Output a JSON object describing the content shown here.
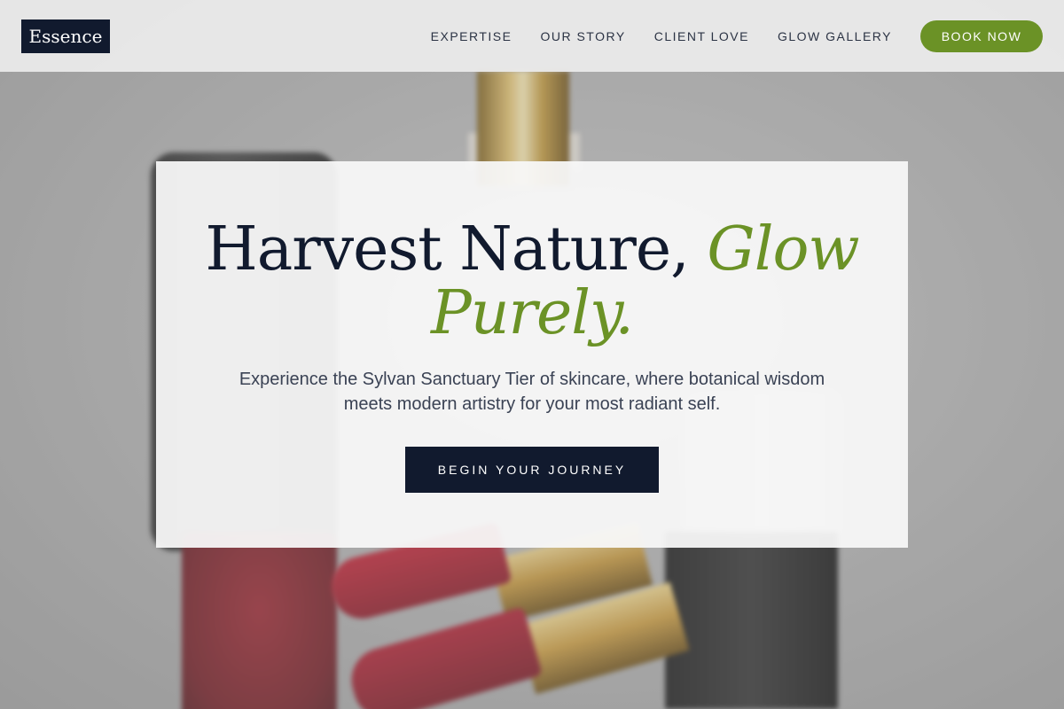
{
  "brand": {
    "logo_text": "Essence"
  },
  "nav": {
    "items": [
      {
        "label": "EXPERTISE"
      },
      {
        "label": "OUR STORY"
      },
      {
        "label": "CLIENT LOVE"
      },
      {
        "label": "GLOW GALLERY"
      }
    ],
    "cta_label": "BOOK NOW"
  },
  "hero": {
    "headline_main": "Harvest Nature, ",
    "headline_accent": "Glow Purely.",
    "subtext": "Experience the Sylvan Sanctuary Tier of skincare, where botanical wisdom meets modern artistry for your most radiant self.",
    "cta_label": "BEGIN YOUR JOURNEY"
  },
  "colors": {
    "navy": "#111a2e",
    "accent_green": "#6b9226",
    "text_muted": "#3a4254"
  }
}
